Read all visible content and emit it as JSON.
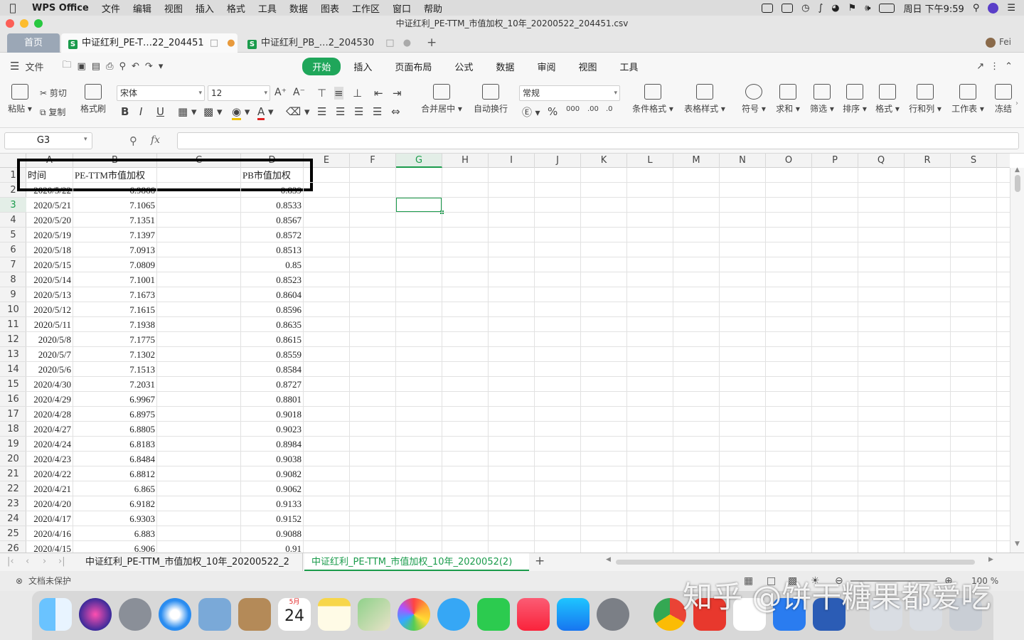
{
  "menubar": {
    "app": "WPS Office",
    "items": [
      "文件",
      "编辑",
      "视图",
      "插入",
      "格式",
      "工具",
      "数据",
      "图表",
      "工作区",
      "窗口",
      "帮助"
    ],
    "clock": "周日 下午9:59"
  },
  "window": {
    "title": "中证红利_PE-TTM_市值加权_10年_20200522_204451.csv"
  },
  "tabs": {
    "home": "首页",
    "doc1": "中证红利_PE-T…22_204451",
    "doc2": "中证红利_PB_…2_204530",
    "user": "Fei"
  },
  "toolbar": {
    "file": "文件",
    "ribbon_tabs": [
      "开始",
      "插入",
      "页面布局",
      "公式",
      "数据",
      "审阅",
      "视图",
      "工具"
    ],
    "active_tab": "开始"
  },
  "ribbon": {
    "paste": "粘贴",
    "cut": "剪切",
    "copy": "复制",
    "format_painter": "格式刷",
    "font": "宋体",
    "size": "12",
    "merge": "合并居中",
    "wrap": "自动换行",
    "number_format": "常规",
    "cond_format": "条件格式",
    "table_style": "表格样式",
    "symbol": "符号",
    "sum": "求和",
    "filter": "筛选",
    "sort": "排序",
    "format": "格式",
    "rowcol": "行和列",
    "sheet": "工作表",
    "freeze": "冻结"
  },
  "formula": {
    "cell_ref": "G3",
    "fx": "fx"
  },
  "columns": [
    "A",
    "B",
    "C",
    "D",
    "E",
    "F",
    "G",
    "H",
    "I",
    "J",
    "K",
    "L",
    "M",
    "N",
    "O",
    "P",
    "Q",
    "R",
    "S"
  ],
  "selected_column": "G",
  "selected_row": 3,
  "header_row": {
    "a": "时间",
    "b": "PE-TTM市值加权",
    "d": "PB市值加权"
  },
  "rows": [
    {
      "n": "2",
      "a": "2020/5/22",
      "b": "6.9866",
      "d": "0.839"
    },
    {
      "n": "3",
      "a": "2020/5/21",
      "b": "7.1065",
      "d": "0.8533"
    },
    {
      "n": "4",
      "a": "2020/5/20",
      "b": "7.1351",
      "d": "0.8567"
    },
    {
      "n": "5",
      "a": "2020/5/19",
      "b": "7.1397",
      "d": "0.8572"
    },
    {
      "n": "6",
      "a": "2020/5/18",
      "b": "7.0913",
      "d": "0.8513"
    },
    {
      "n": "7",
      "a": "2020/5/15",
      "b": "7.0809",
      "d": "0.85"
    },
    {
      "n": "8",
      "a": "2020/5/14",
      "b": "7.1001",
      "d": "0.8523"
    },
    {
      "n": "9",
      "a": "2020/5/13",
      "b": "7.1673",
      "d": "0.8604"
    },
    {
      "n": "10",
      "a": "2020/5/12",
      "b": "7.1615",
      "d": "0.8596"
    },
    {
      "n": "11",
      "a": "2020/5/11",
      "b": "7.1938",
      "d": "0.8635"
    },
    {
      "n": "12",
      "a": "2020/5/8",
      "b": "7.1775",
      "d": "0.8615"
    },
    {
      "n": "13",
      "a": "2020/5/7",
      "b": "7.1302",
      "d": "0.8559"
    },
    {
      "n": "14",
      "a": "2020/5/6",
      "b": "7.1513",
      "d": "0.8584"
    },
    {
      "n": "15",
      "a": "2020/4/30",
      "b": "7.2031",
      "d": "0.8727"
    },
    {
      "n": "16",
      "a": "2020/4/29",
      "b": "6.9967",
      "d": "0.8801"
    },
    {
      "n": "17",
      "a": "2020/4/28",
      "b": "6.8975",
      "d": "0.9018"
    },
    {
      "n": "18",
      "a": "2020/4/27",
      "b": "6.8805",
      "d": "0.9023"
    },
    {
      "n": "19",
      "a": "2020/4/24",
      "b": "6.8183",
      "d": "0.8984"
    },
    {
      "n": "20",
      "a": "2020/4/23",
      "b": "6.8484",
      "d": "0.9038"
    },
    {
      "n": "21",
      "a": "2020/4/22",
      "b": "6.8812",
      "d": "0.9082"
    },
    {
      "n": "22",
      "a": "2020/4/21",
      "b": "6.865",
      "d": "0.9062"
    },
    {
      "n": "23",
      "a": "2020/4/20",
      "b": "6.9182",
      "d": "0.9133"
    },
    {
      "n": "24",
      "a": "2020/4/17",
      "b": "6.9303",
      "d": "0.9152"
    },
    {
      "n": "25",
      "a": "2020/4/16",
      "b": "6.883",
      "d": "0.9088"
    },
    {
      "n": "26",
      "a": "2020/4/15",
      "b": "6.906",
      "d": "0.91"
    }
  ],
  "sheets": {
    "sheet1": "中证红利_PE-TTM_市值加权_10年_20200522_2",
    "sheet2": "中证红利_PE-TTM_市值加权_10年_2020052(2)"
  },
  "status": {
    "protect": "文档未保护",
    "zoom": "100 %"
  },
  "watermark": "知乎 @饼干糖果都爱吃",
  "dock": {
    "calendar_month": "5月",
    "calendar_day": "24"
  },
  "colors": {
    "accent": "#1a9b4b",
    "annotation": "#000000"
  }
}
